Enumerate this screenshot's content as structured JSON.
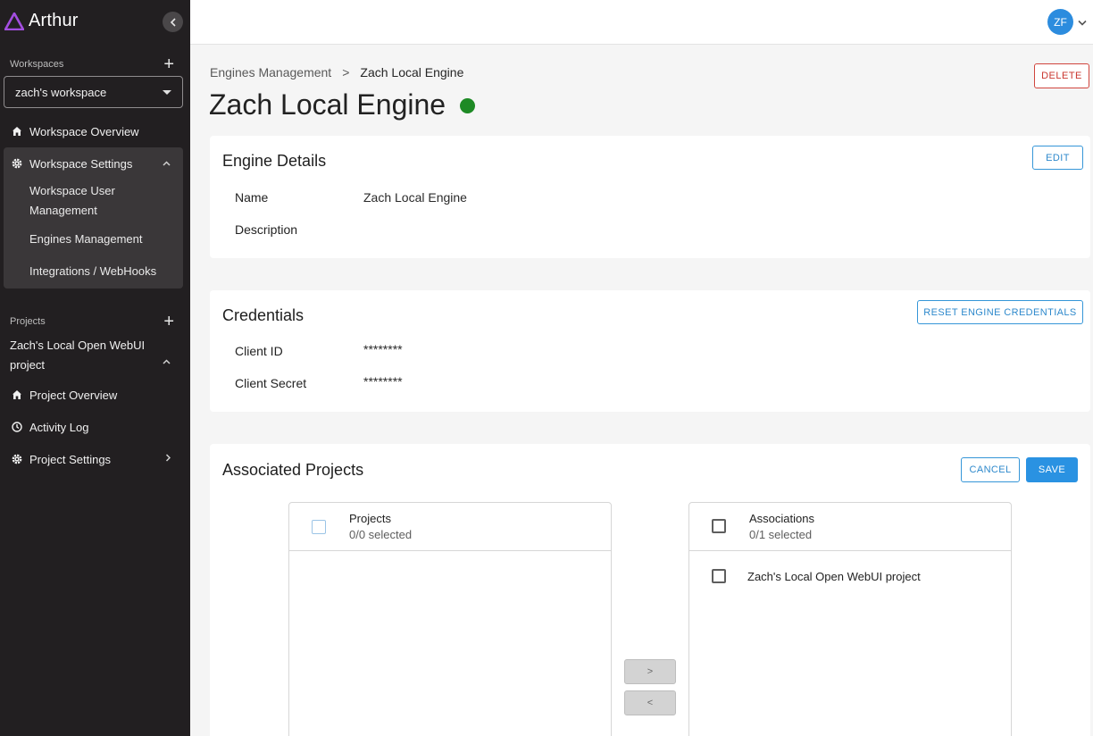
{
  "app": {
    "name": "Arthur"
  },
  "sidebar": {
    "workspaces_label": "Workspaces",
    "workspace_selected": "zach's workspace",
    "workspace_overview": "Workspace Overview",
    "workspace_settings": "Workspace Settings",
    "settings_items": [
      "Workspace User Management",
      "Engines Management",
      "Integrations / WebHooks"
    ],
    "projects_label": "Projects",
    "project_name": "Zach's Local Open WebUI project",
    "project_overview": "Project Overview",
    "activity_log": "Activity Log",
    "project_settings": "Project Settings"
  },
  "topbar": {
    "avatar_initials": "ZF"
  },
  "breadcrumb": {
    "parent": "Engines Management",
    "separator": ">",
    "current": "Zach Local Engine"
  },
  "page": {
    "title": "Zach Local Engine",
    "status_color": "#1e8a25",
    "delete_label": "DELETE"
  },
  "engine_details": {
    "title": "Engine Details",
    "edit_label": "EDIT",
    "name_label": "Name",
    "name_value": "Zach Local Engine",
    "description_label": "Description",
    "description_value": ""
  },
  "credentials": {
    "title": "Credentials",
    "reset_label": "RESET ENGINE CREDENTIALS",
    "client_id_label": "Client ID",
    "client_id_value": "********",
    "client_secret_label": "Client Secret",
    "client_secret_value": "********"
  },
  "associated_projects": {
    "title": "Associated Projects",
    "cancel_label": "CANCEL",
    "save_label": "SAVE",
    "left_panel": {
      "title": "Projects",
      "selected": "0/0 selected",
      "items": []
    },
    "right_panel": {
      "title": "Associations",
      "selected": "0/1 selected",
      "items": [
        "Zach's Local Open WebUI project"
      ]
    },
    "move_right_label": ">",
    "move_left_label": "<"
  },
  "colors": {
    "accent": "#2a92e2",
    "sidebar_bg": "#221f21",
    "danger": "#c9352e",
    "logo": "#a34ee0"
  }
}
